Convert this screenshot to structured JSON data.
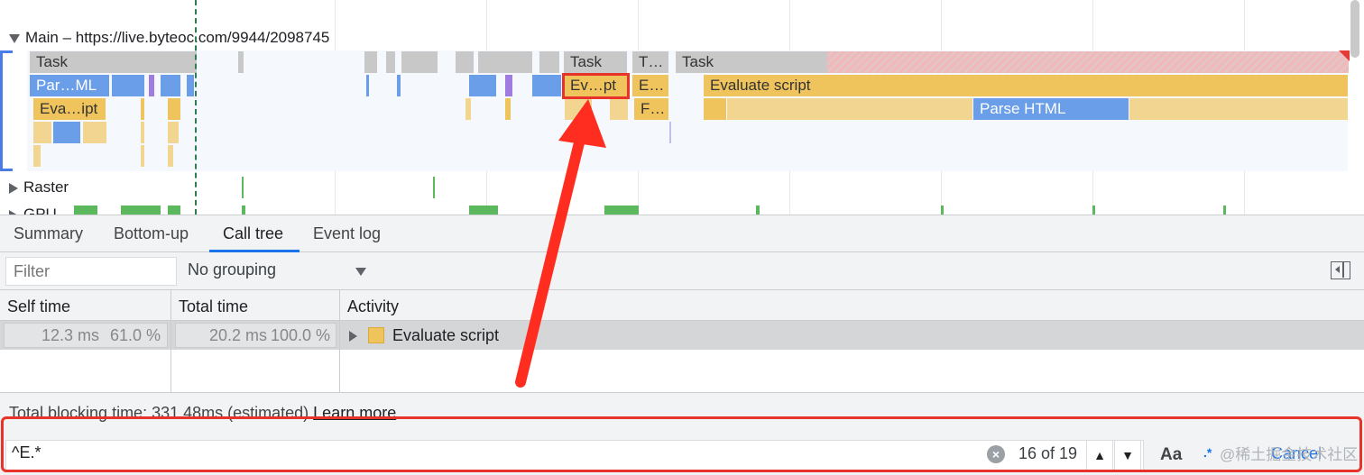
{
  "flame_chart": {
    "main_track_title": "Main – https://live.byteoc.com/9944/2098745",
    "tracks": [
      "Raster",
      "GPU"
    ],
    "events": {
      "task_1": "Task",
      "task_2": "Task",
      "task_3": "T…",
      "task_4": "Task",
      "parse_1": "Par…ML",
      "eval_highlight": "Ev…pt",
      "eval_short": "E…",
      "evaluate_script": "Evaluate script",
      "eval_2": "Eva…ipt",
      "func_short": "F…",
      "parse_html": "Parse HTML"
    },
    "colors": {
      "task": "#c8c8c8",
      "parse_html": "#6a9ee8",
      "evaluate_script": "#f0c45c",
      "gpu": "#5cb85c",
      "annotation": "#e8332a"
    }
  },
  "tabs": [
    {
      "label": "Summary",
      "active": false
    },
    {
      "label": "Bottom-up",
      "active": false
    },
    {
      "label": "Call tree",
      "active": true
    },
    {
      "label": "Event log",
      "active": false
    }
  ],
  "toolbar": {
    "filter_placeholder": "Filter",
    "grouping_value": "No grouping"
  },
  "table": {
    "columns": [
      "Self time",
      "Total time",
      "Activity"
    ],
    "rows": [
      {
        "self_time": "12.3 ms",
        "self_pct": "61.0 %",
        "total_time": "20.2 ms",
        "total_pct": "100.0 %",
        "activity": "Evaluate script"
      }
    ]
  },
  "footer": {
    "blocking_text": "Total blocking time: 331.48ms (estimated)",
    "learn_more": "Learn more"
  },
  "search": {
    "query": "^E.*",
    "match_count": "16 of 19",
    "case_label": "Aa",
    "regex_label": ".*",
    "cancel_label": "Cancel"
  },
  "watermark": "@稀土掘金技术社区"
}
